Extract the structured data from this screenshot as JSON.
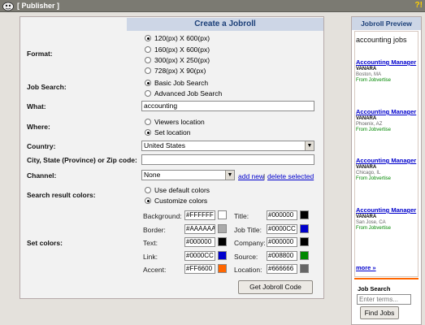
{
  "topbar": {
    "title": "[ Publisher ]",
    "help": "?!"
  },
  "panel": {
    "title": "Create a Jobroll"
  },
  "format": {
    "label": "Format:",
    "options": [
      "120(px) X 600(px)",
      "160(px) X 600(px)",
      "300(px) X 250(px)",
      "728(px) X 90(px)"
    ],
    "selected": 0
  },
  "job_search": {
    "label": "Job Search:",
    "options": [
      "Basic Job Search",
      "Advanced Job Search"
    ],
    "selected": 0
  },
  "what": {
    "label": "What:",
    "value": "accounting"
  },
  "where": {
    "label": "Where:",
    "options": [
      "Viewers location",
      "Set location"
    ],
    "selected": 1
  },
  "country": {
    "label": "Country:",
    "value": "United States"
  },
  "city": {
    "label": "City, State (Province) or Zip code:",
    "value": ""
  },
  "channel": {
    "label": "Channel:",
    "value": "None",
    "add": "add new",
    "sep": "|",
    "delete": "delete selected"
  },
  "result_colors": {
    "label": "Search result colors:",
    "options": [
      "Use default colors",
      "Customize colors"
    ],
    "selected": 1
  },
  "set_colors": {
    "label": "Set colors:",
    "left": [
      {
        "name": "Background:",
        "value": "#FFFFFF",
        "color": "#FFFFFF"
      },
      {
        "name": "Border:",
        "value": "#AAAAAA",
        "color": "#AAAAAA"
      },
      {
        "name": "Text:",
        "value": "#000000",
        "color": "#000000"
      },
      {
        "name": "Link:",
        "value": "#0000CC",
        "color": "#0000CC"
      },
      {
        "name": "Accent:",
        "value": "#FF6600",
        "color": "#FF6600"
      }
    ],
    "right": [
      {
        "name": "Title:",
        "value": "#000000",
        "color": "#000000"
      },
      {
        "name": "Job Title:",
        "value": "#0000CC",
        "color": "#0000CC"
      },
      {
        "name": "Company:",
        "value": "#000000",
        "color": "#000000"
      },
      {
        "name": "Source:",
        "value": "#008800",
        "color": "#008800"
      },
      {
        "name": "Location:",
        "value": "#666666",
        "color": "#666666"
      }
    ]
  },
  "get_code": {
    "label": "Get Jobroll Code"
  },
  "preview": {
    "title": "Jobroll Preview",
    "query": "accounting jobs",
    "jobs": [
      {
        "title": "Accounting Manager",
        "company": "VANARA",
        "location": "Boston, MA",
        "source": "From Jobvertise"
      },
      {
        "title": "Accounting Manager",
        "company": "VANARA",
        "location": "Phoenix, AZ",
        "source": "From Jobvertise"
      },
      {
        "title": "Accounting Manager",
        "company": "VANARA",
        "location": "Chicago, IL",
        "source": "From Jobvertise"
      },
      {
        "title": "Accounting Manager",
        "company": "VANARA",
        "location": "San Jose, CA",
        "source": "From Jobvertise"
      }
    ],
    "more": "more »",
    "search_label": "Job Search",
    "search_placeholder": "Enter terms...",
    "find_button": "Find Jobs"
  }
}
